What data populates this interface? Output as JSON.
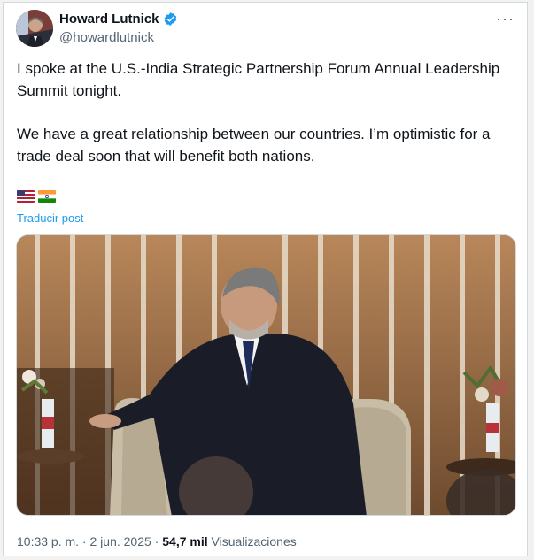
{
  "tweet": {
    "author": {
      "display_name": "Howard Lutnick",
      "handle": "@howardlutnick",
      "verified": true,
      "verified_color": "#1d9bf0"
    },
    "more_icon": "more-horizontal-icon",
    "more_glyph": "···",
    "paragraph_1": "I spoke at the U.S.-India Strategic Partnership Forum Annual Leadership Summit tonight.",
    "paragraph_2": "We have a great relationship between our countries. I’m optimistic for a trade deal soon that will benefit both nations.",
    "flags": [
      "us-flag-icon",
      "india-flag-icon"
    ],
    "translate_label": "Traducir post",
    "meta": {
      "time": "10:33 p. m.",
      "separator": " · ",
      "date": "2 jun. 2025",
      "views_count": "54,7 mil",
      "views_label": "Visualizaciones"
    }
  },
  "colors": {
    "link": "#1d9bf0",
    "secondary_text": "#536471",
    "primary_text": "#0f1419",
    "border": "#cfd9de"
  }
}
